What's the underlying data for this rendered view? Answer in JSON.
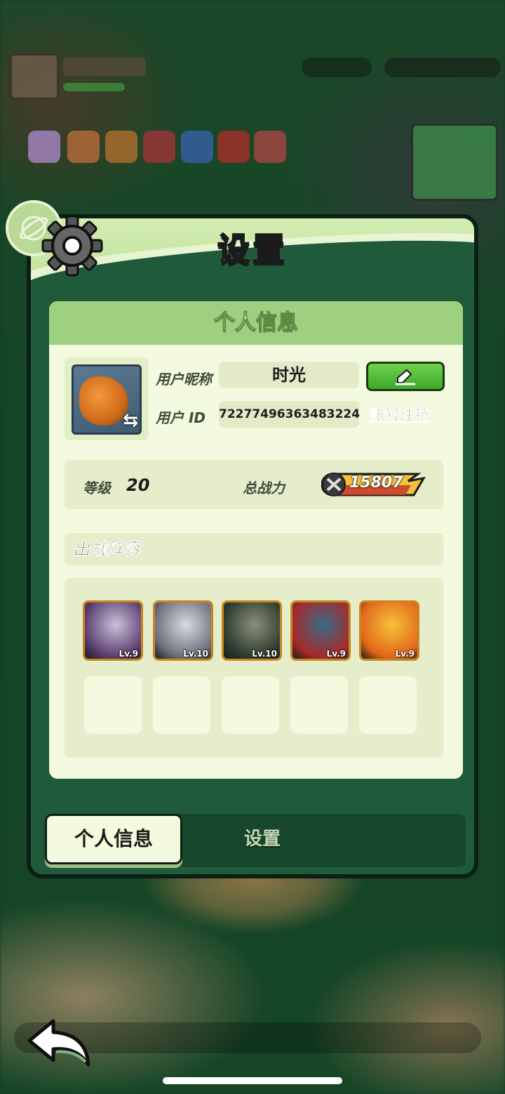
{
  "panel": {
    "title": "设置"
  },
  "card": {
    "header": "个人信息",
    "nickname_label": "用户昵称",
    "nickname_value": "时光",
    "id_label": "用户 ID",
    "id_value": "72277496363483224",
    "cancel_account": "账号注销",
    "level_label": "等级",
    "level_value": "20",
    "power_label": "总战力",
    "power_value": "15807",
    "lineup_title": "出战阵容"
  },
  "lineup": {
    "heroes": [
      {
        "level": "Lv.9",
        "colors": [
          "#5a3c6e",
          "#c9c2d8"
        ]
      },
      {
        "level": "Lv.10",
        "colors": [
          "#6b6f7a",
          "#d8dbe0"
        ]
      },
      {
        "level": "Lv.10",
        "colors": [
          "#2d3a2e",
          "#8b8f7a"
        ]
      },
      {
        "level": "Lv.9",
        "colors": [
          "#a62a2a",
          "#3a6a86"
        ]
      },
      {
        "level": "Lv.9",
        "colors": [
          "#e2661a",
          "#f6c23a"
        ]
      }
    ]
  },
  "tabs": {
    "profile": "个人信息",
    "settings": "设置"
  },
  "colors": {
    "accent_green": "#3da82a",
    "power_gold": "#f1c23a",
    "panel_dark": "#1f5b3a"
  }
}
